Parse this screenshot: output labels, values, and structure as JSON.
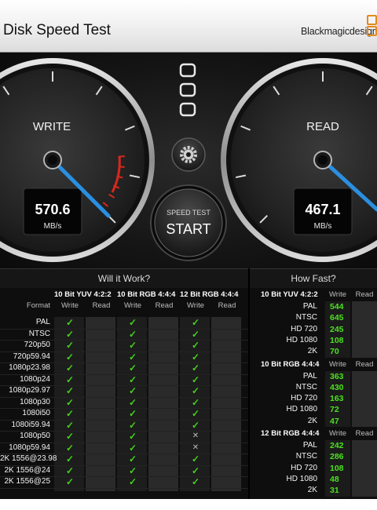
{
  "window": {
    "title": "Disk Speed Test",
    "brand": "Blackmagicdesign"
  },
  "gauges": {
    "write": {
      "label": "WRITE",
      "value": "570.6",
      "unit": "MB/s"
    },
    "read": {
      "label": "READ",
      "value": "467.1",
      "unit": "MB/s"
    }
  },
  "start_button": {
    "caption": "SPEED TEST",
    "label": "START"
  },
  "will_it_work": {
    "title": "Will it Work?",
    "format_header": "Format",
    "groups": [
      "10 Bit YUV 4:2:2",
      "10 Bit RGB 4:4:4",
      "12 Bit RGB 4:4:4"
    ],
    "sub_headers": [
      "Write",
      "Read"
    ],
    "rows": [
      {
        "format": "PAL",
        "support": [
          "yes",
          "yes",
          "yes"
        ]
      },
      {
        "format": "NTSC",
        "support": [
          "yes",
          "yes",
          "yes"
        ]
      },
      {
        "format": "720p50",
        "support": [
          "yes",
          "yes",
          "yes"
        ]
      },
      {
        "format": "720p59.94",
        "support": [
          "yes",
          "yes",
          "yes"
        ]
      },
      {
        "format": "1080p23.98",
        "support": [
          "yes",
          "yes",
          "yes"
        ]
      },
      {
        "format": "1080p24",
        "support": [
          "yes",
          "yes",
          "yes"
        ]
      },
      {
        "format": "1080p29.97",
        "support": [
          "yes",
          "yes",
          "yes"
        ]
      },
      {
        "format": "1080p30",
        "support": [
          "yes",
          "yes",
          "yes"
        ]
      },
      {
        "format": "1080i50",
        "support": [
          "yes",
          "yes",
          "yes"
        ]
      },
      {
        "format": "1080i59.94",
        "support": [
          "yes",
          "yes",
          "yes"
        ]
      },
      {
        "format": "1080p50",
        "support": [
          "yes",
          "yes",
          "no"
        ]
      },
      {
        "format": "1080p59.94",
        "support": [
          "yes",
          "yes",
          "no"
        ]
      },
      {
        "format": "2K 1556@23.98",
        "support": [
          "yes",
          "yes",
          "yes"
        ]
      },
      {
        "format": "2K 1556@24",
        "support": [
          "yes",
          "yes",
          "yes"
        ]
      },
      {
        "format": "2K 1556@25",
        "support": [
          "yes",
          "yes",
          "yes"
        ]
      }
    ]
  },
  "how_fast": {
    "title": "How Fast?",
    "sub_headers": [
      "Write",
      "Read"
    ],
    "groups": [
      {
        "name": "10 Bit YUV 4:2:2",
        "rows": [
          {
            "format": "PAL",
            "write": "544"
          },
          {
            "format": "NTSC",
            "write": "645"
          },
          {
            "format": "HD 720",
            "write": "245"
          },
          {
            "format": "HD 1080",
            "write": "108"
          },
          {
            "format": "2K",
            "write": "70"
          }
        ]
      },
      {
        "name": "10 Bit RGB 4:4:4",
        "rows": [
          {
            "format": "PAL",
            "write": "363"
          },
          {
            "format": "NTSC",
            "write": "430"
          },
          {
            "format": "HD 720",
            "write": "163"
          },
          {
            "format": "HD 1080",
            "write": "72"
          },
          {
            "format": "2K",
            "write": "47"
          }
        ]
      },
      {
        "name": "12 Bit RGB 4:4:4",
        "rows": [
          {
            "format": "PAL",
            "write": "242"
          },
          {
            "format": "NTSC",
            "write": "286"
          },
          {
            "format": "HD 720",
            "write": "108"
          },
          {
            "format": "HD 1080",
            "write": "48"
          },
          {
            "format": "2K",
            "write": "31"
          }
        ]
      }
    ]
  },
  "icons": {
    "check": "check-icon",
    "cross": "cross-icon",
    "settings": "gear-icon",
    "target": "target-select-icon"
  },
  "colors": {
    "needle": "#2a8fe0",
    "redline": "#d7281d",
    "check": "#46d11c",
    "value": "#4ce21e",
    "logo": "#e48a1c"
  }
}
